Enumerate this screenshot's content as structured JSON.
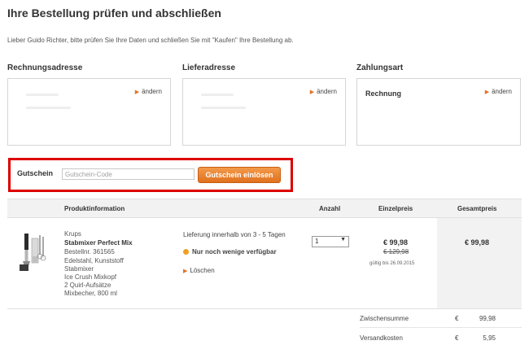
{
  "page": {
    "title": "Ihre Bestellung prüfen und abschließen",
    "intro": "Lieber Guido Richter, bitte prüfen Sie Ihre Daten und schließen Sie mit \"Kaufen\" Ihre Bestellung ab."
  },
  "addresses": {
    "billing_title": "Rechnungsadresse",
    "shipping_title": "Lieferadresse",
    "payment_title": "Zahlungsart",
    "change_label": "ändern",
    "payment_value": "Rechnung"
  },
  "voucher": {
    "label": "Gutschein",
    "placeholder": "Gutschein-Code",
    "button": "Gutschein einlösen"
  },
  "table": {
    "headers": {
      "product": "Produktinformation",
      "quantity": "Anzahl",
      "unit_price": "Einzelpreis",
      "total_price": "Gesamtpreis"
    }
  },
  "product": {
    "brand": "Krups",
    "name": "Stabmixer Perfect Mix",
    "order_no": "Bestellnr. 361565",
    "details": [
      "Edelstahl, Kunststoff",
      "Stabmixer",
      "Ice Crush Mixkopf",
      "2 Quirl-Aufsätze",
      "Mixbecher, 800 ml"
    ],
    "delivery": "Lieferung innerhalb von 3 - 5 Tagen",
    "stock": "Nur noch wenige verfügbar",
    "delete_label": "Löschen",
    "quantity": "1",
    "unit_price": "€ 99,98",
    "old_price": "€ 129,98",
    "valid_until": "gültig bis 26.09.2015",
    "total_price": "€ 99,98"
  },
  "summary": {
    "subtotal_label": "Zwischensumme",
    "subtotal_currency": "€",
    "subtotal_value": "99,98",
    "shipping_label": "Versandkosten",
    "shipping_currency": "€",
    "shipping_value": "5,95"
  },
  "colors": {
    "accent": "#e37222",
    "highlight_frame": "#dd0000",
    "stock_dot": "#f0a020"
  }
}
